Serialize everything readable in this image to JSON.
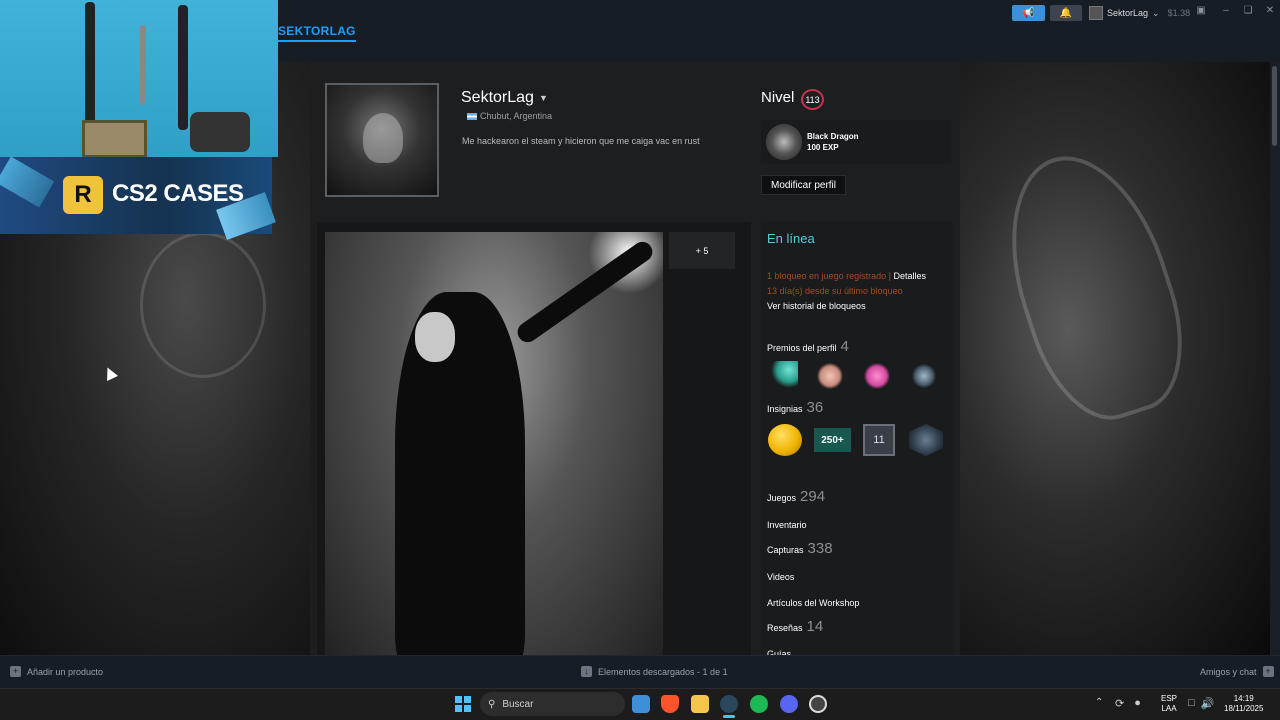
{
  "topbar": {
    "nav_title": "SEKTORLAG",
    "user_name": "SektorLag",
    "wallet": "$1.38"
  },
  "profile": {
    "name": "SektorLag",
    "location": "Chubut, Argentina",
    "summary": "Me hackearon el steam y hicieron que me caiga vac en rust",
    "level_label": "Nivel",
    "level": "113",
    "badge_name": "Black Dragon",
    "badge_xp": "100 EXP",
    "edit_button": "Modificar perfil"
  },
  "showcase": {
    "more_label": "+ 5"
  },
  "sidebar": {
    "status": "En línea",
    "ban_line1": "1 bloqueo en juego registrado |",
    "ban_details": "Detalles",
    "ban_line2": "13 día(s) desde su último bloqueo",
    "ban_history": "Ver historial de bloqueos",
    "awards_label": "Premios del perfil",
    "awards_count": "4",
    "badges_label": "Insignias",
    "badges_count": "36",
    "badge_250_text": "250+",
    "badge_11_text": "11",
    "games_label": "Juegos",
    "games_count": "294",
    "inventory_label": "Inventario",
    "screenshots_label": "Capturas",
    "screenshots_count": "338",
    "videos_label": "Videos",
    "workshop_label": "Artículos del Workshop",
    "reviews_label": "Reseñas",
    "reviews_count": "14",
    "guides_label": "Guías"
  },
  "overlay": {
    "cases_text": "CS2 CASES",
    "cases_logo": "R"
  },
  "bottombar": {
    "add_product": "Añadir un producto",
    "downloads": "Elementos descargados - 1 de 1",
    "friends": "Amigos y chat"
  },
  "taskbar": {
    "search": "Buscar",
    "lang_top": "ESP",
    "lang_bottom": "LAA",
    "time": "14:19",
    "date": "18/11/2025"
  }
}
